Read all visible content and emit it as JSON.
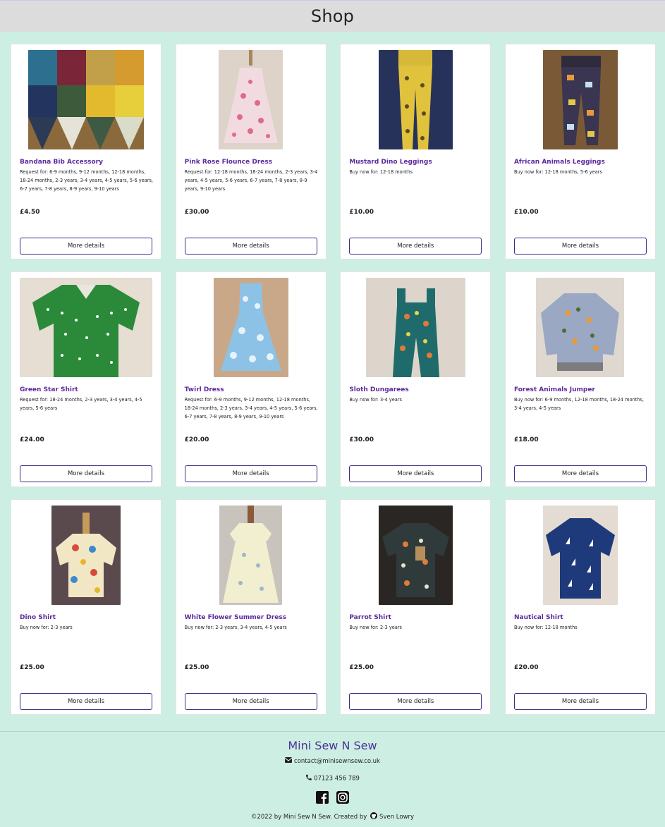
{
  "header": {
    "title": "Shop"
  },
  "products": [
    {
      "title": "Bandana Bib Accessory",
      "availability": "Request for: 6-9 months, 9-12 months, 12-18 months, 18-24 months, 2-3 years, 3-4 years, 4-5 years, 5-6 years, 6-7 years, 7-8 years, 8-9 years, 9-10 years",
      "price": "£4.50",
      "button": "More details",
      "image": "bandana-bibs-photo"
    },
    {
      "title": "Pink Rose Flounce Dress",
      "availability": "Request for: 12-18 months, 18-24 months, 2-3 years, 3-4 years, 4-5 years, 5-6 years, 6-7 years, 7-8 years, 8-9 years, 9-10 years",
      "price": "£30.00",
      "button": "More details",
      "image": "pink-dress-photo"
    },
    {
      "title": "Mustard Dino Leggings",
      "availability": "Buy now for: 12-18 months",
      "price": "£10.00",
      "button": "More details",
      "image": "mustard-leggings-photo"
    },
    {
      "title": "African Animals Leggings",
      "availability": "Buy now for: 12-18 months, 5-6 years",
      "price": "£10.00",
      "button": "More details",
      "image": "animal-leggings-photo"
    },
    {
      "title": "Green Star Shirt",
      "availability": "Request for: 18-24 months, 2-3 years, 3-4 years, 4-5 years, 5-6 years",
      "price": "£24.00",
      "button": "More details",
      "image": "green-shirt-photo"
    },
    {
      "title": "Twirl Dress",
      "availability": "Request for: 6-9 months, 9-12 months, 12-18 months, 18-24 months, 2-3 years, 3-4 years, 4-5 years, 5-6 years, 6-7 years, 7-8 years, 8-9 years, 9-10 years",
      "price": "£20.00",
      "button": "More details",
      "image": "twirl-dress-photo"
    },
    {
      "title": "Sloth Dungarees",
      "availability": "Buy now for: 3-4 years",
      "price": "£30.00",
      "button": "More details",
      "image": "sloth-dungarees-photo"
    },
    {
      "title": "Forest Animals Jumper",
      "availability": "Buy now for: 6-9 months, 12-18 months, 18-24 months, 3-4 years, 4-5 years",
      "price": "£18.00",
      "button": "More details",
      "image": "jumper-photo"
    },
    {
      "title": "Dino Shirt",
      "availability": "Buy now for: 2-3 years",
      "price": "£25.00",
      "button": "More details",
      "image": "dino-shirt-photo"
    },
    {
      "title": "White Flower Summer Dress",
      "availability": "Buy now for: 2-3 years, 3-4 years, 4-5 years",
      "price": "£25.00",
      "button": "More details",
      "image": "white-dress-photo"
    },
    {
      "title": "Parrot Shirt",
      "availability": "Buy now for: 2-3 years",
      "price": "£25.00",
      "button": "More details",
      "image": "parrot-shirt-photo"
    },
    {
      "title": "Nautical Shirt",
      "availability": "Buy now for: 12-18 months",
      "price": "£20.00",
      "button": "More details",
      "image": "nautical-shirt-photo"
    }
  ],
  "footer": {
    "brand": "Mini Sew N Sew",
    "email": "contact@minisewnsew.co.uk",
    "phone": "07123 456 789",
    "socials": [
      "facebook-icon",
      "instagram-icon"
    ],
    "copyright": "©2022 by Mini Sew N Sew. Created by",
    "author": "Sven Lowry"
  },
  "colors": {
    "background": "#cdeee3",
    "header": "#dcdcdc",
    "title": "#5b2a9e",
    "button_border": "#3e2a84",
    "brand": "#4b3399"
  }
}
